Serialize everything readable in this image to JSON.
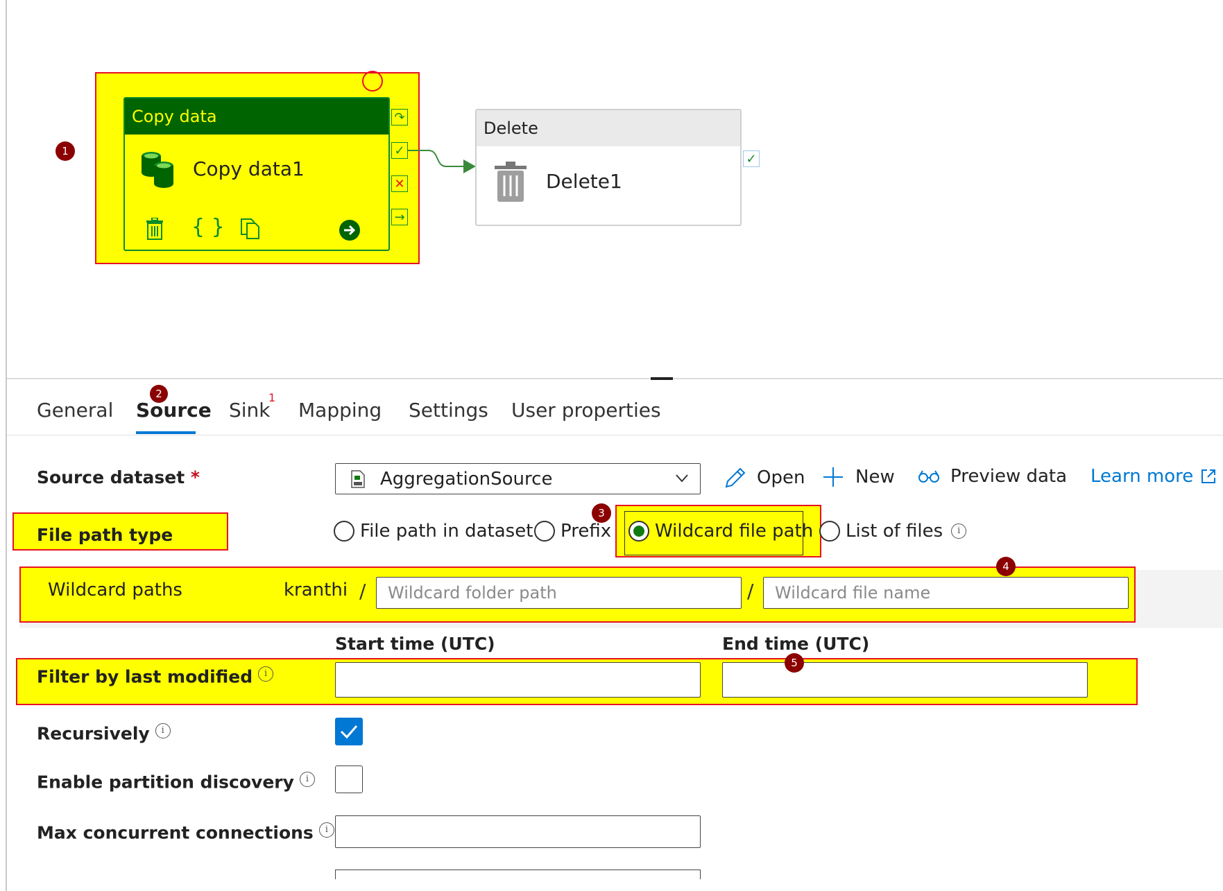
{
  "canvas": {
    "copy_activity": {
      "type_label": "Copy data",
      "name": "Copy data1",
      "badge": "1"
    },
    "delete_activity": {
      "type_label": "Delete",
      "name": "Delete1"
    }
  },
  "tabs": [
    {
      "label": "General"
    },
    {
      "label": "Source",
      "badge": "2",
      "active": true
    },
    {
      "label": "Sink",
      "superscript": "1"
    },
    {
      "label": "Mapping"
    },
    {
      "label": "Settings"
    },
    {
      "label": "User properties"
    }
  ],
  "source": {
    "dataset_label": "Source dataset",
    "required_mark": "*",
    "dataset_value": "AggregationSource",
    "actions": {
      "open": "Open",
      "new": "New",
      "preview": "Preview data",
      "learn_more": "Learn more"
    },
    "file_path_type_label": "File path type",
    "file_path_options": [
      {
        "label": "File path in dataset",
        "selected": false
      },
      {
        "label": "Prefix",
        "selected": false
      },
      {
        "label": "Wildcard file path",
        "selected": true
      },
      {
        "label": "List of files",
        "selected": false
      }
    ],
    "badge_3": "3",
    "wildcard_label": "Wildcard paths",
    "wildcard_container": "kranthi",
    "separator": "/",
    "wildcard_folder_placeholder": "Wildcard folder path",
    "wildcard_file_placeholder": "Wildcard file name",
    "badge_4": "4",
    "start_time_label": "Start time (UTC)",
    "end_time_label": "End time (UTC)",
    "filter_label": "Filter by last modified",
    "badge_5": "5",
    "recursively_label": "Recursively",
    "recursively_checked": true,
    "partition_label": "Enable partition discovery",
    "partition_checked": false,
    "max_conn_label": "Max concurrent connections",
    "max_conn_value": ""
  },
  "colors": {
    "highlight": "#ffff00",
    "annotation_border": "#e81123",
    "badge": "#8b0000",
    "accent": "#0078d4",
    "success": "#107c10",
    "activity_header": "#006400"
  }
}
